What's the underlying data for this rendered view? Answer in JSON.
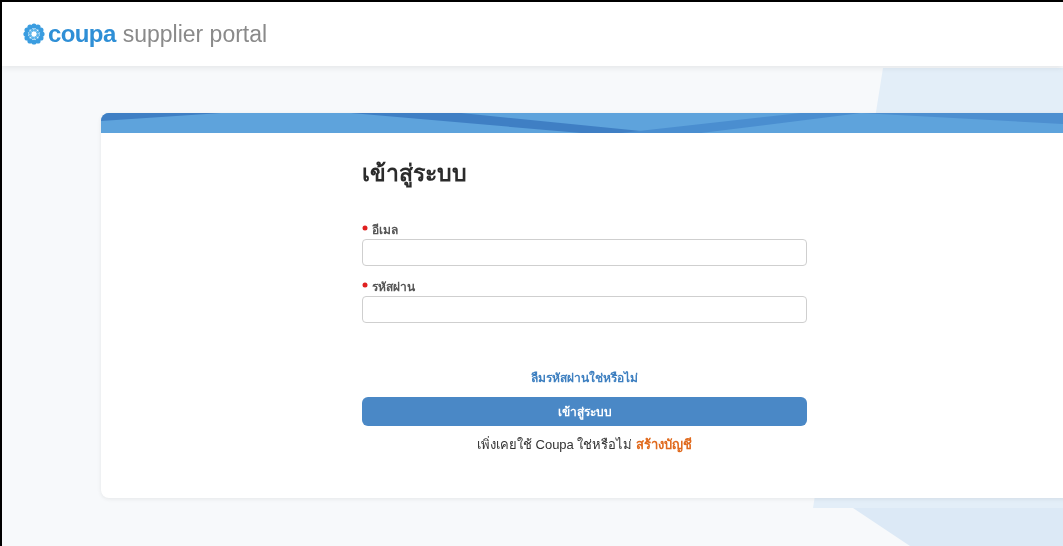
{
  "header": {
    "logo_brand": "coupa",
    "logo_product": "supplier portal"
  },
  "login": {
    "title": "เข้าสู่ระบบ",
    "fields": [
      {
        "label": "อีเมล",
        "required": true
      },
      {
        "label": "รหัสผ่าน",
        "required": true
      }
    ],
    "forgot_link": "ลืมรหัสผ่านใช่หรือไม่",
    "submit_button": "เข้าสู่ระบบ",
    "signup_prompt": "เพิ่งเคยใช้ Coupa ใช่หรือไม่",
    "signup_link": "สร้างบัญชี"
  }
}
